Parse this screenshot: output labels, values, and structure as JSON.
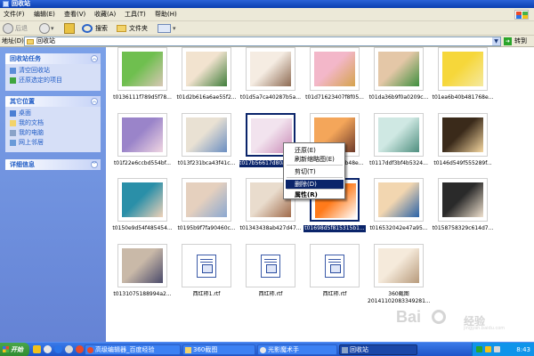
{
  "window": {
    "title": "回收站"
  },
  "menu": [
    "文件(F)",
    "编辑(E)",
    "查看(V)",
    "收藏(A)",
    "工具(T)",
    "帮助(H)"
  ],
  "toolbar": {
    "back": "后退",
    "search": "搜索",
    "folders": "文件夹"
  },
  "address": {
    "label": "地址(D)",
    "value": "回收站",
    "go": "转到"
  },
  "left_pane": {
    "panels": [
      {
        "title": "回收站任务",
        "items": [
          "清空回收站",
          "还原选定的项目"
        ]
      },
      {
        "title": "其它位置",
        "items": [
          "桌面",
          "我的文档",
          "我的电脑",
          "网上邻居"
        ]
      },
      {
        "title": "详细信息",
        "items": []
      }
    ]
  },
  "files": [
    {
      "name": "t0136111f789d5f78...",
      "kind": "photo",
      "colors": [
        "#6fbf4f",
        "#d8c7b5"
      ]
    },
    {
      "name": "t01d2b616a6ae55f2...",
      "kind": "photo",
      "colors": [
        "#f2e3cf",
        "#3f7d3a"
      ]
    },
    {
      "name": "t01d5a7ca40287b5a...",
      "kind": "photo",
      "colors": [
        "#f5ece2",
        "#8e6b53"
      ]
    },
    {
      "name": "t01d71623407f8f05...",
      "kind": "photo",
      "colors": [
        "#f3b7c9",
        "#d5a34d"
      ]
    },
    {
      "name": "t01da36b9f0a0209c...",
      "kind": "photo",
      "colors": [
        "#e4c7a7",
        "#3f8f3f"
      ]
    },
    {
      "name": "t01ea6b40b481768e...",
      "kind": "photo",
      "colors": [
        "#f6d73a",
        "#f5e9a0"
      ]
    },
    {
      "name": "t01f22e6ccbd554bf...",
      "kind": "photo",
      "colors": [
        "#9a84c9",
        "#f0d6e2"
      ]
    },
    {
      "name": "t013f231bca43f41c...",
      "kind": "photo",
      "colors": [
        "#e9e1d3",
        "#6a8ec2"
      ]
    },
    {
      "name": "t017b56617d80a01...jpg",
      "kind": "photo",
      "colors": [
        "#f2e3ee",
        "#c98ab6"
      ],
      "selected": true
    },
    {
      "name": "t0114a02b2e9b48e...",
      "kind": "photo",
      "colors": [
        "#f4a65a",
        "#6d3a2a"
      ]
    },
    {
      "name": "t0117ddf3bf4b5324...",
      "kind": "photo",
      "colors": [
        "#cfe8e3",
        "#4f8f7f"
      ]
    },
    {
      "name": "t0146d549f555289f...",
      "kind": "photo",
      "colors": [
        "#3a2a1a",
        "#f5d7a0"
      ]
    },
    {
      "name": "t0150e9d54f485454...",
      "kind": "photo",
      "colors": [
        "#2a8fa8",
        "#f0d2b8"
      ]
    },
    {
      "name": "t0195b9f7fa90460c...",
      "kind": "photo",
      "colors": [
        "#e5d0be",
        "#8aa8d1"
      ]
    },
    {
      "name": "t01343438ab427d47...",
      "kind": "photo",
      "colors": [
        "#e9dccd",
        "#a06b4b"
      ]
    },
    {
      "name": "t01698d5f815315b1...",
      "kind": "photo",
      "colors": [
        "#ff7a1a",
        "#ffffff"
      ],
      "selected": true
    },
    {
      "name": "t016532042e47a95...",
      "kind": "photo",
      "colors": [
        "#f2d6b0",
        "#2a63a8"
      ]
    },
    {
      "name": "t0158758329c614d7...",
      "kind": "photo",
      "colors": [
        "#2a2a2a",
        "#f0e2cf"
      ]
    },
    {
      "name": "t0131075188994a2...",
      "kind": "photo",
      "colors": [
        "#c9b9a8",
        "#4a4a6a"
      ]
    },
    {
      "name": "西红柿1.rtf",
      "kind": "doc"
    },
    {
      "name": "西红柿.rtf",
      "kind": "doc"
    },
    {
      "name": "西红柿.rtf",
      "kind": "doc"
    },
    {
      "name": "360截图 20141102083349281...",
      "kind": "photo",
      "colors": [
        "#f5eadb",
        "#b79a7b"
      ]
    }
  ],
  "context_menu": [
    {
      "label": "还原(E)",
      "highlight": false
    },
    {
      "label": "刷新缩略图(E)",
      "highlight": false
    },
    {
      "label": "剪切(T)",
      "highlight": false
    },
    {
      "label": "删除(D)",
      "highlight": true
    },
    {
      "label": "属性(R)",
      "highlight": false,
      "bold": true
    }
  ],
  "taskbar": {
    "start": "开始",
    "buttons": [
      {
        "label": "高级编辑器_百度经验",
        "active": false
      },
      {
        "label": "360截图",
        "active": false
      },
      {
        "label": "光影魔术手",
        "active": false
      },
      {
        "label": "回收站",
        "active": true
      }
    ],
    "clock": "8:43"
  },
  "watermark": {
    "logo": "Bai",
    "suffix": "经验",
    "url": "jingyan.baidu.com"
  }
}
